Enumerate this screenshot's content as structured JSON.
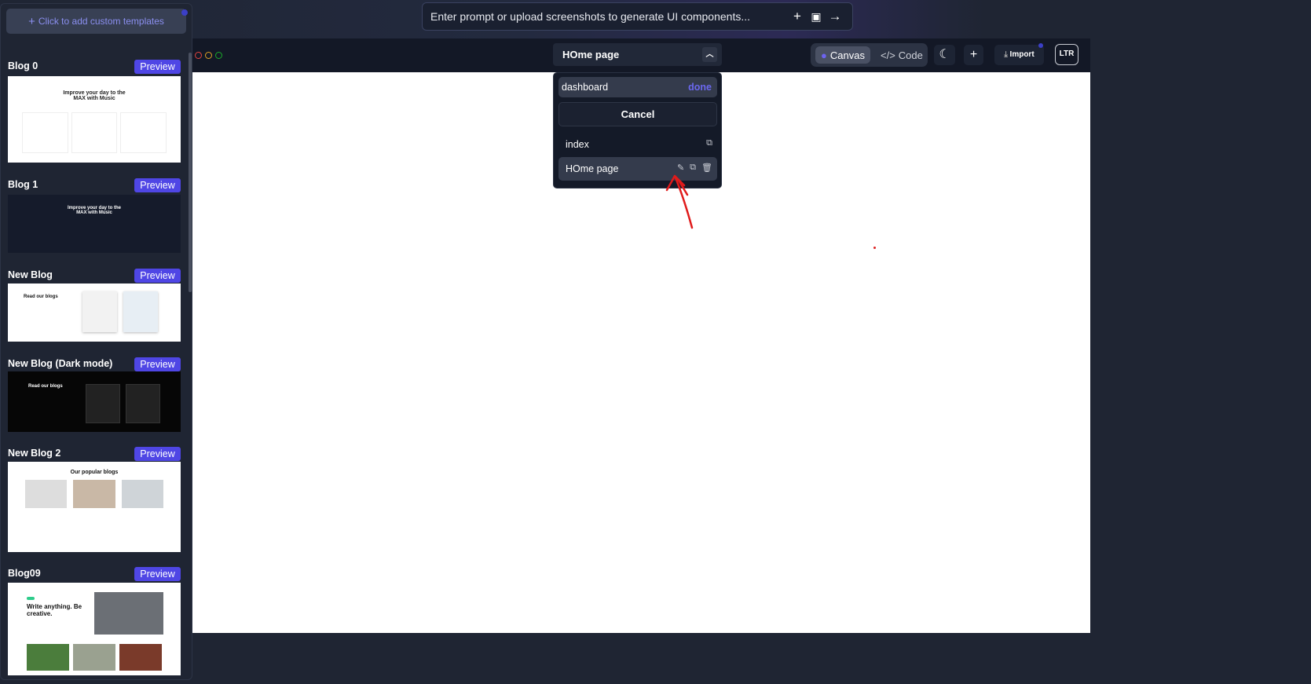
{
  "prompt_bar": {
    "placeholder": "Enter prompt or upload screenshots to generate UI components...",
    "icons": [
      "plus-icon",
      "image-upload-icon",
      "arrow-right-icon"
    ]
  },
  "sidebar": {
    "add_templates": "Click to add custom templates",
    "templates": [
      {
        "title": "Blog 0",
        "preview": "Preview",
        "thumb_heading": "Improve your day to the MAX with Music"
      },
      {
        "title": "Blog 1",
        "preview": "Preview",
        "thumb_heading": "Improve your day to the MAX with Music"
      },
      {
        "title": "New Blog",
        "preview": "Preview",
        "thumb_heading": "Read our blogs"
      },
      {
        "title": "New Blog (Dark mode)",
        "preview": "Preview",
        "thumb_heading": "Read our blogs"
      },
      {
        "title": "New Blog 2",
        "preview": "Preview",
        "thumb_heading": "Our popular blogs"
      },
      {
        "title": "Blog09",
        "preview": "Preview",
        "thumb_heading": "Write anything. Be creative."
      }
    ]
  },
  "toolbar": {
    "page_selector": "HOme page",
    "canvas_label": "Canvas",
    "code_label": "Code",
    "import_label": "Import",
    "direction": "LTR",
    "window_dot_colors": [
      "#e0443e",
      "#dea123",
      "#1aab29"
    ],
    "accent": "#4f46e5"
  },
  "page_menu": {
    "rename_value": "dashboard",
    "done_label": "done",
    "cancel_label": "Cancel",
    "pages": [
      {
        "name": "index"
      },
      {
        "name": "HOme page"
      }
    ]
  }
}
